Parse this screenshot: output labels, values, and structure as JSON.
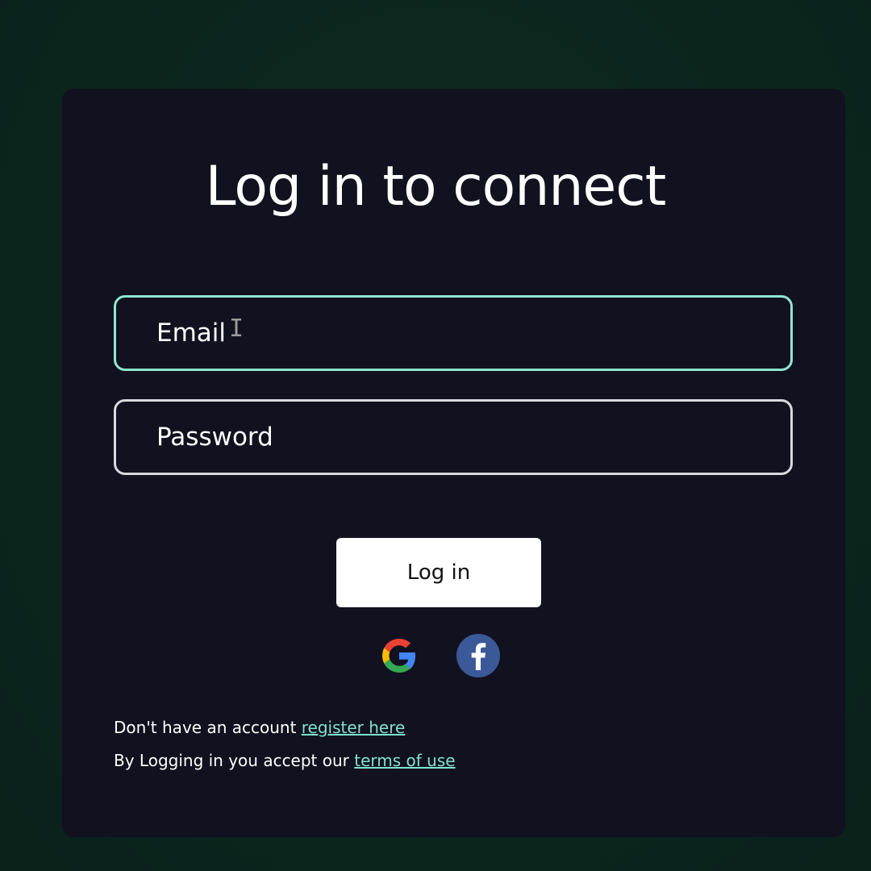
{
  "login": {
    "title": "Log in to connect",
    "email_placeholder": "Email",
    "password_placeholder": "Password",
    "login_button": "Log in",
    "footer": {
      "register_prefix": "Don't have an account ",
      "register_link": "register here",
      "terms_prefix": "By Logging in you accept our ",
      "terms_link": "terms of use"
    },
    "social": {
      "google_icon": "google-icon",
      "facebook_icon": "facebook-icon"
    }
  },
  "colors": {
    "background": "#0c2a21",
    "card": "#11111f",
    "accent": "#8ee6d2",
    "link": "#7fe3cf",
    "button": "#ffffff"
  }
}
